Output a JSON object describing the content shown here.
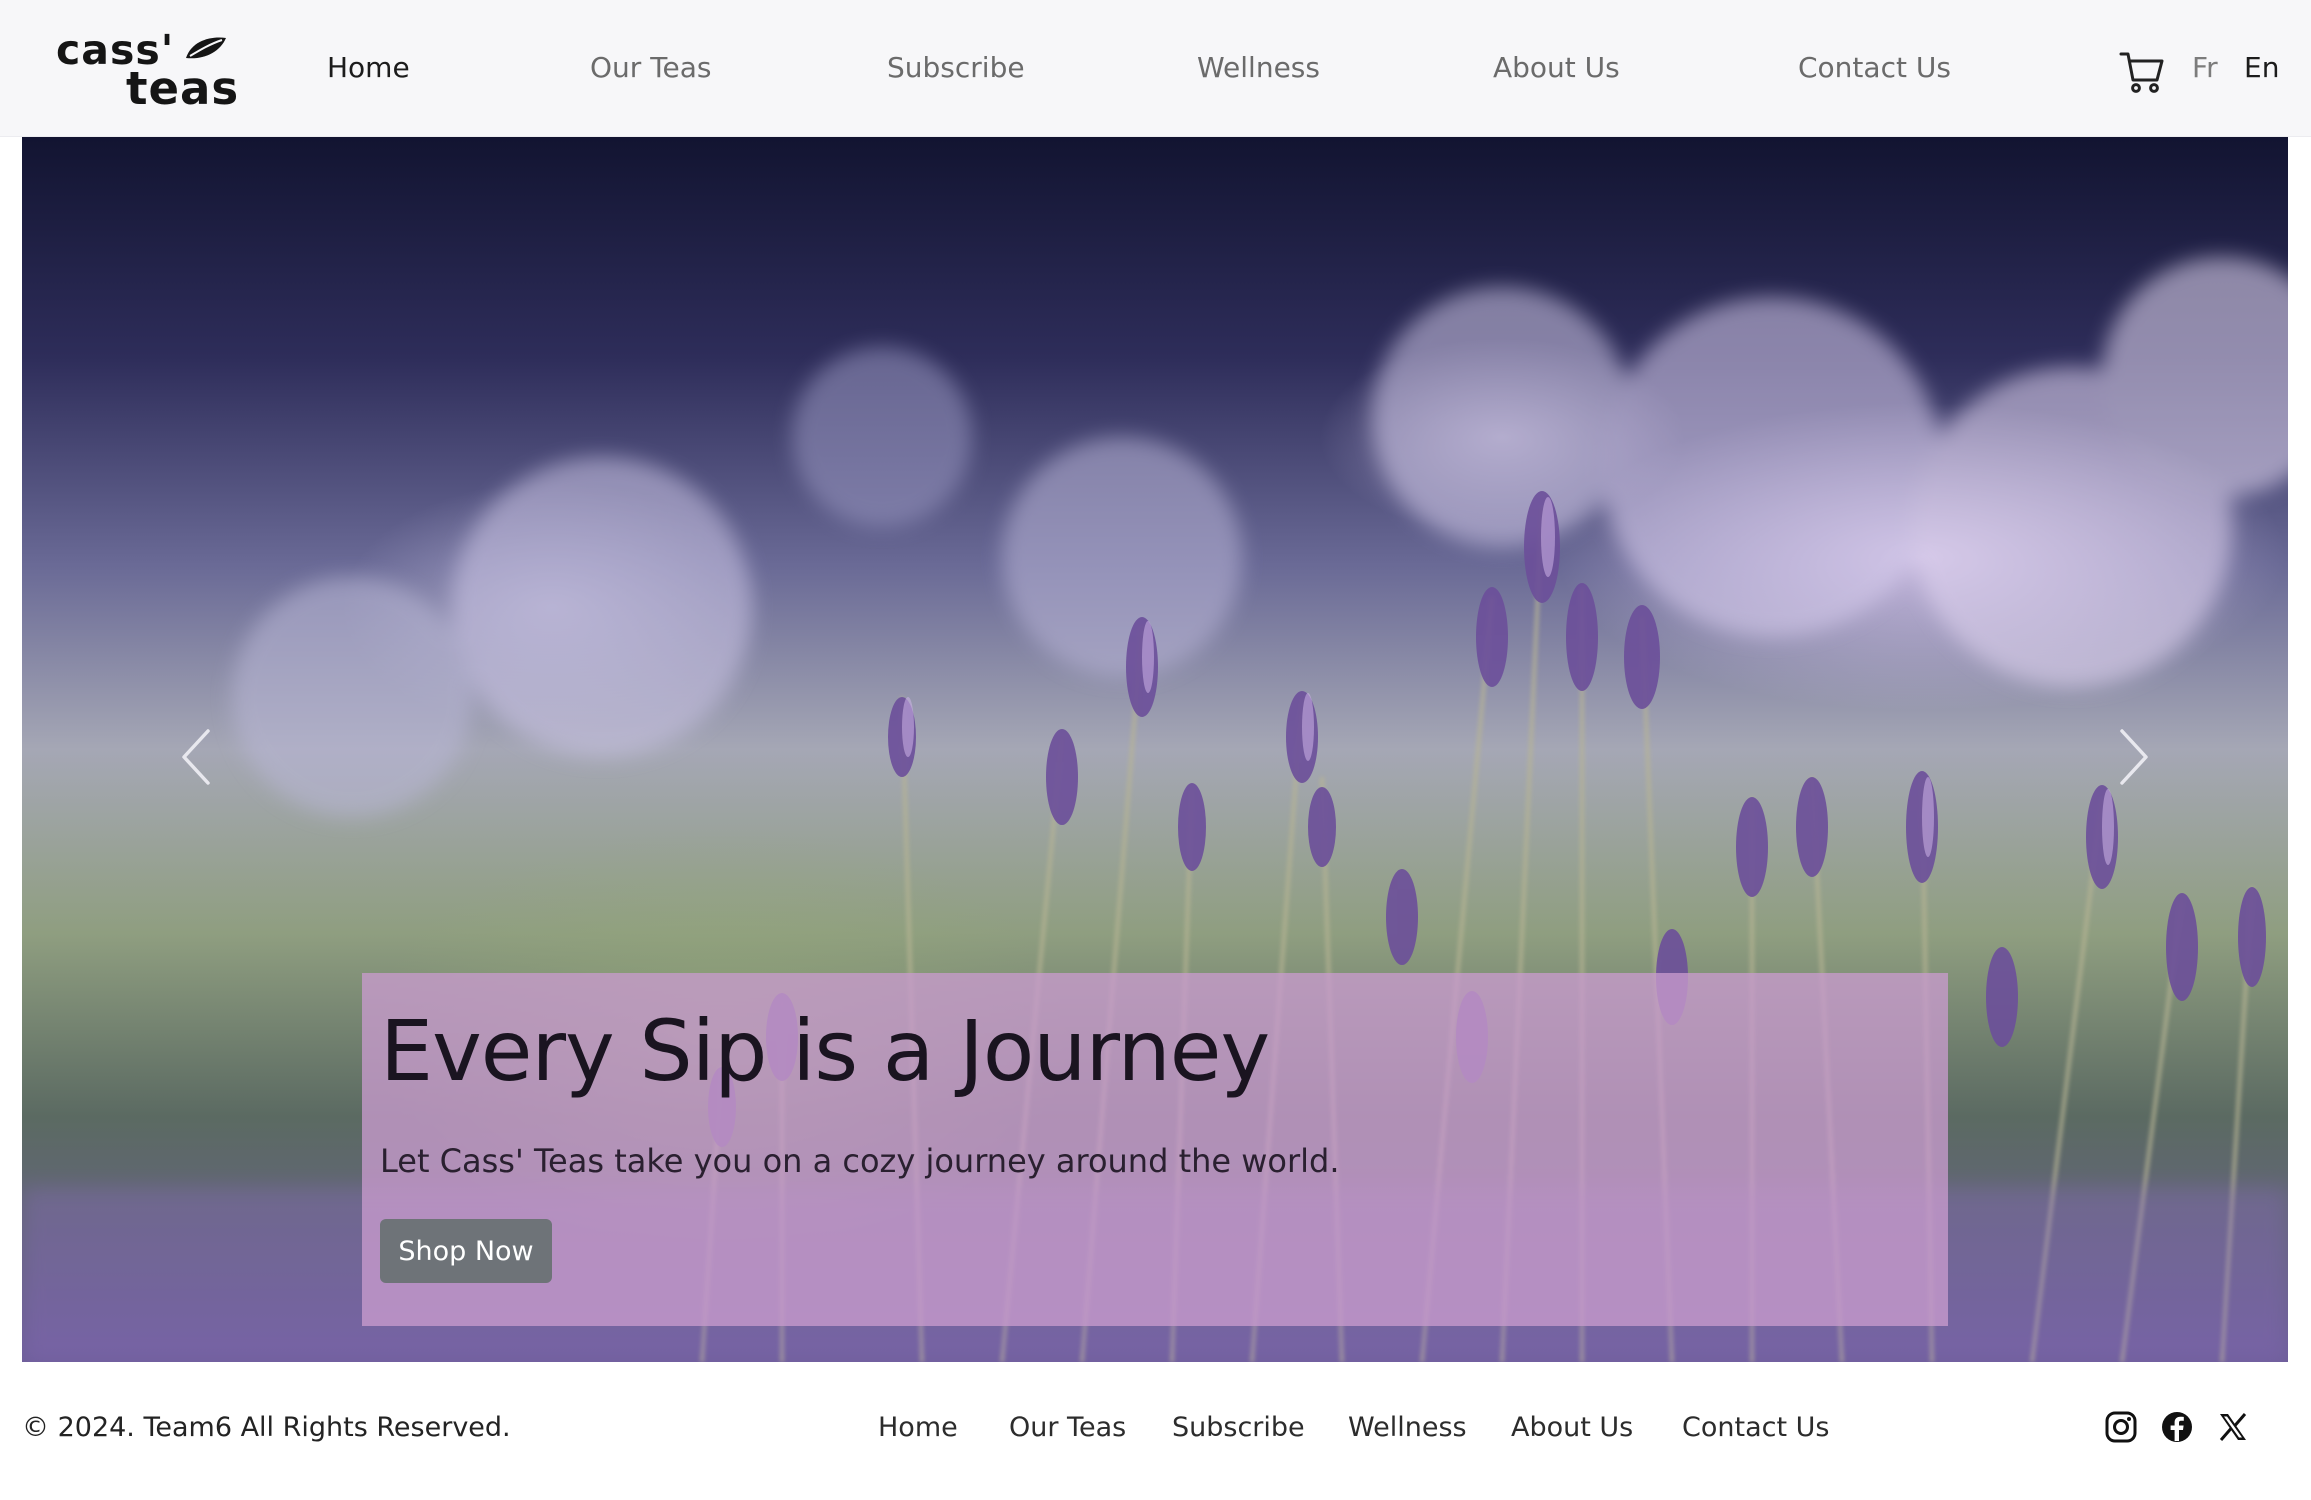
{
  "brand": {
    "logo_line1": "cass'",
    "logo_line2": "teas"
  },
  "nav": {
    "links": [
      {
        "label": "Home",
        "active": true
      },
      {
        "label": "Our Teas",
        "active": false
      },
      {
        "label": "Subscribe",
        "active": false
      },
      {
        "label": "Wellness",
        "active": false
      },
      {
        "label": "About Us",
        "active": false
      },
      {
        "label": "Contact Us",
        "active": false
      }
    ],
    "cart_icon": "shopping-cart-icon",
    "languages": {
      "fr": "Fr",
      "en": "En",
      "selected": "En"
    }
  },
  "hero": {
    "title": "Every Sip is a Journey",
    "subtitle": "Let Cass' Teas take you on a cozy journey around the world.",
    "button": "Shop Now",
    "prev_icon": "chevron-left-icon",
    "next_icon": "chevron-right-icon"
  },
  "footer": {
    "copyright": "© 2024. Team6 All Rights Reserved.",
    "links": [
      "Home",
      "Our Teas",
      "Subscribe",
      "Wellness",
      "About Us",
      "Contact Us"
    ],
    "social": [
      "instagram-icon",
      "facebook-icon",
      "x-twitter-icon"
    ]
  },
  "colors": {
    "nav_bg": "#f7f7f9",
    "caption_bg": "#c89bcd",
    "button_bg": "#6e7378",
    "text_dark": "#1c1c1c",
    "text_muted": "#6b6b6b"
  }
}
